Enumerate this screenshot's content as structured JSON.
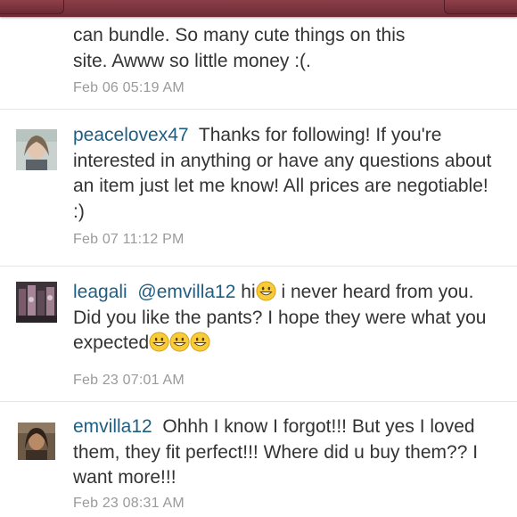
{
  "comments": [
    {
      "text_line1": "can bundle. So many cute things on this",
      "text_line2": "site.  Awww so little money :(.",
      "time": "Feb 06 05:19 AM"
    },
    {
      "user": "peacelovex47",
      "message": "Thanks for following! If you're interested in anything or have any questions about an item just let me know! All prices are negotiable! :)",
      "time": "Feb 07 11:12 PM"
    },
    {
      "user": "leagali",
      "mention": "@emvilla12",
      "message_part1": "hi",
      "message_part2": "i never heard from you. Did you like the pants? I hope they were what you expected",
      "time": "Feb 23 07:01 AM"
    },
    {
      "user": "emvilla12",
      "message": "Ohhh I know I forgot!!! But yes I loved them, they fit perfect!!! Where did u buy them?? I want more!!!",
      "time": "Feb 23 08:31 AM"
    }
  ],
  "colors": {
    "username": "#1f5e83",
    "timestamp": "#9a9a9a",
    "body_text": "#333333",
    "top_bar": "#7a323c"
  },
  "icons": {
    "emoji": "grinning-face-icon"
  }
}
